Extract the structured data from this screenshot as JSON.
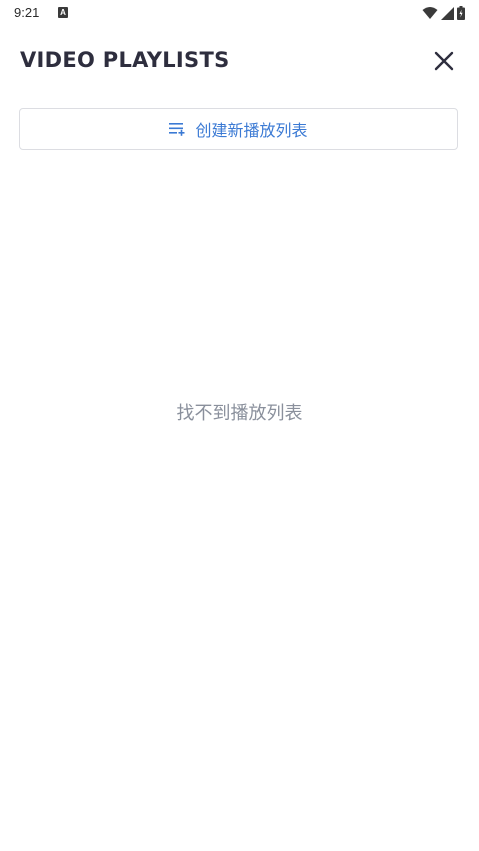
{
  "status_bar": {
    "time": "9:21",
    "notification_badge": "A"
  },
  "header": {
    "title": "VIDEO PLAYLISTS",
    "close_icon": "close-icon"
  },
  "create_button": {
    "label": "创建新播放列表",
    "icon": "playlist-add-icon",
    "color": "#3b7ad4"
  },
  "empty_state": {
    "message": "找不到播放列表"
  }
}
